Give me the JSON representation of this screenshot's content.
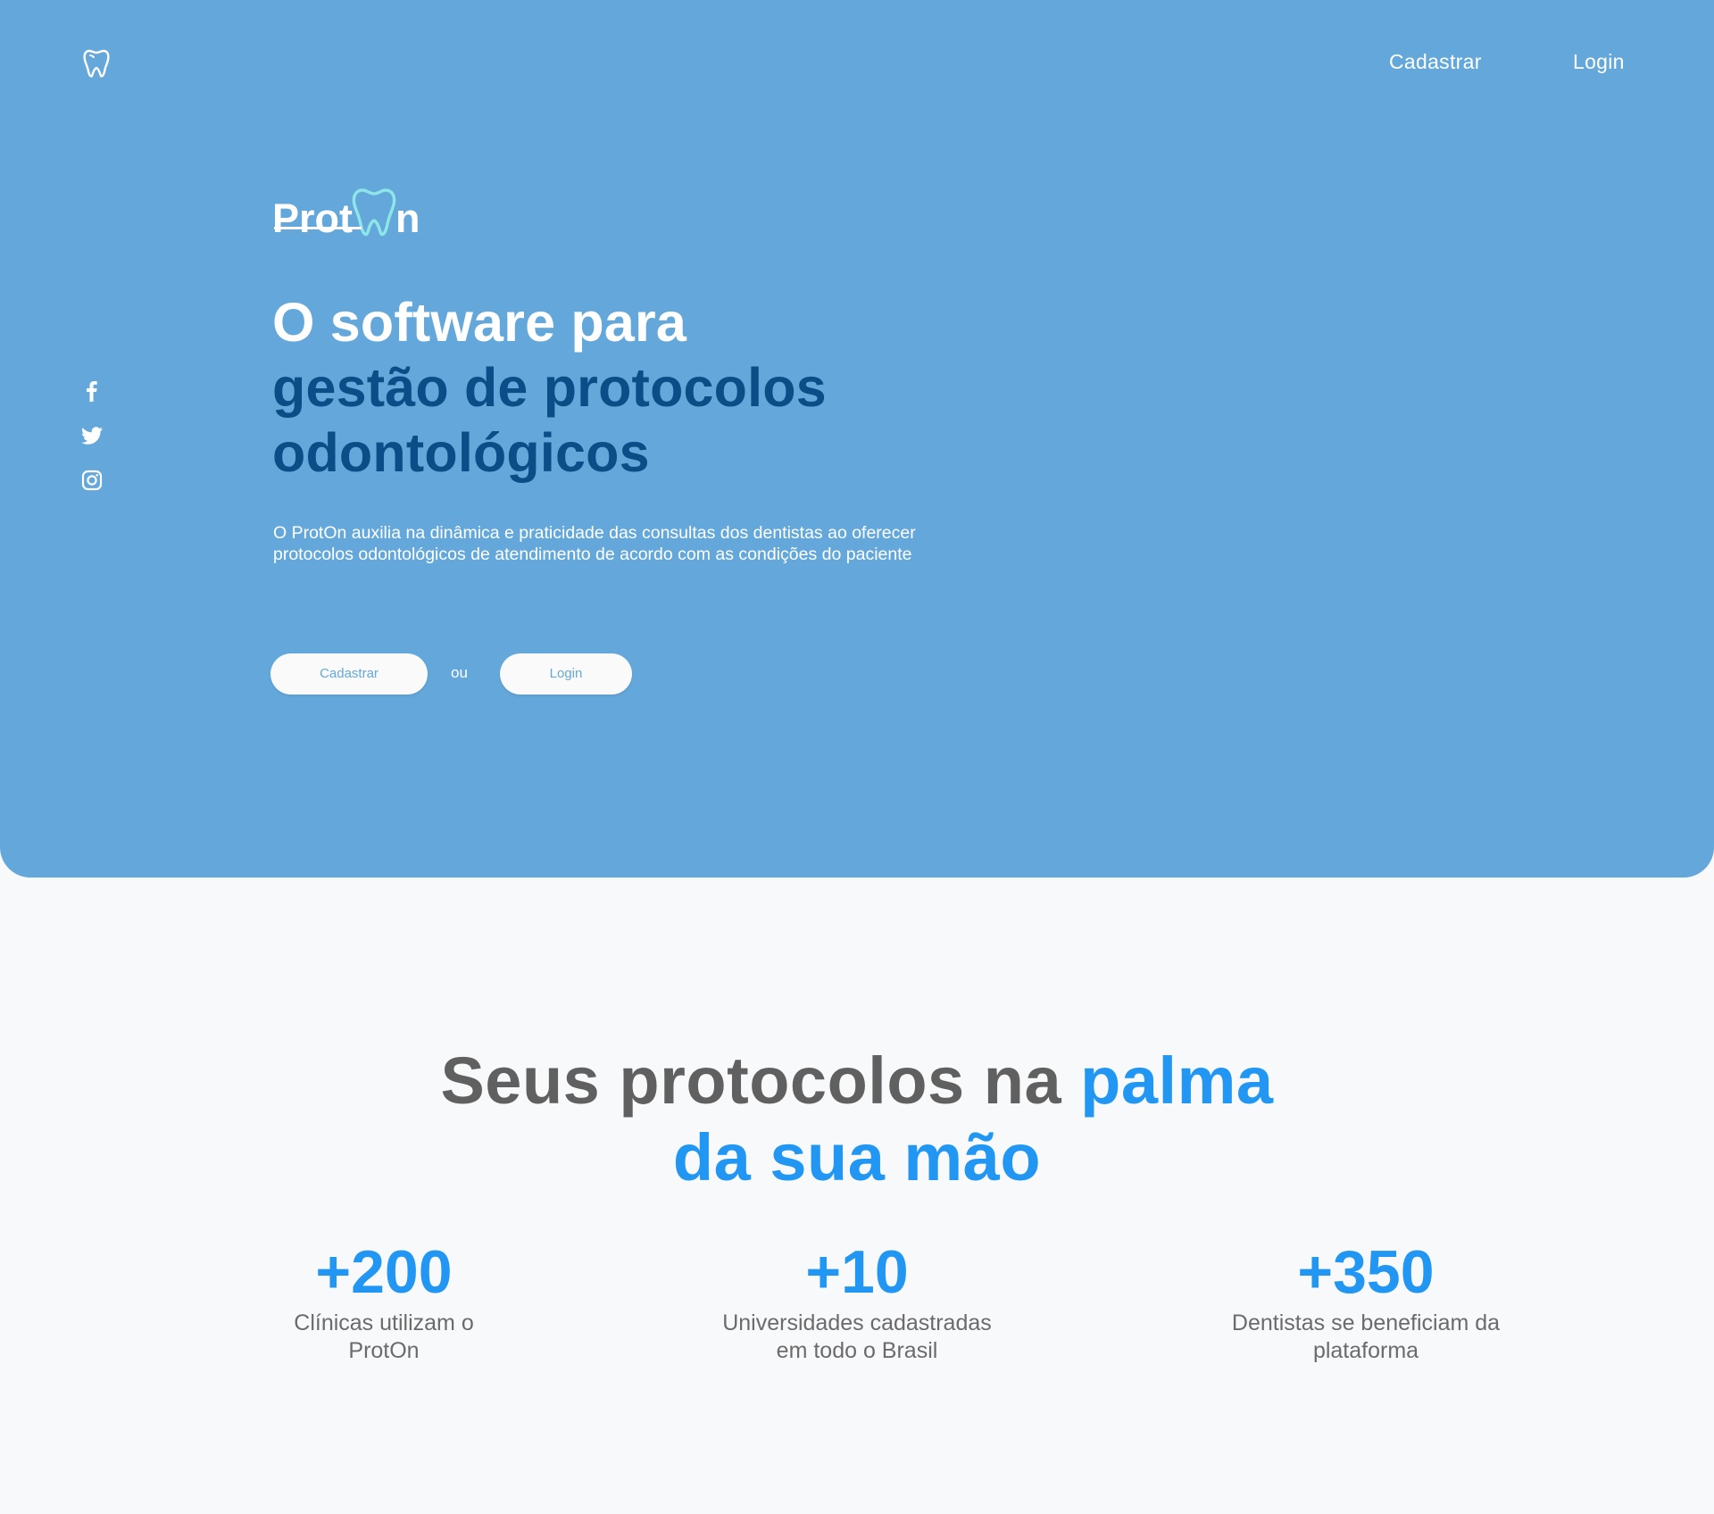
{
  "nav": {
    "logo_icon": "tooth-icon",
    "register_label": "Cadastrar",
    "login_label": "Login"
  },
  "social": {
    "icons": [
      "facebook-icon",
      "twitter-icon",
      "instagram-icon"
    ]
  },
  "brand": {
    "text_before": "Prot",
    "text_after": "n",
    "icon": "tooth-icon",
    "accent_color": "#8ee6e6"
  },
  "hero": {
    "headline_line1": "O software para",
    "headline_line2": "gestão de protocolos",
    "headline_line3": "odontológicos",
    "description": "O ProtOn auxilia na dinâmica e praticidade das consultas dos dentistas ao oferecer protocolos odontológicos de atendimento de acordo com as condições do paciente",
    "register_button": "Cadastrar",
    "or_text": "ou",
    "login_button": "Login",
    "background_color": "#64a8db",
    "headline_accent_color": "#0b4d86"
  },
  "stats_section": {
    "title_gray": "Seus protocolos na ",
    "title_blue_1": "palma",
    "title_blue_2": "da sua mão",
    "accent_color": "#2196f3",
    "stats": [
      {
        "value": "+200",
        "caption_line1": "Clínicas utilizam o",
        "caption_line2": "ProtOn"
      },
      {
        "value": "+10",
        "caption_line1": "Universidades cadastradas",
        "caption_line2": "em todo o Brasil"
      },
      {
        "value": "+350",
        "caption_line1": "Dentistas se beneficiam da",
        "caption_line2": "plataforma"
      }
    ]
  }
}
